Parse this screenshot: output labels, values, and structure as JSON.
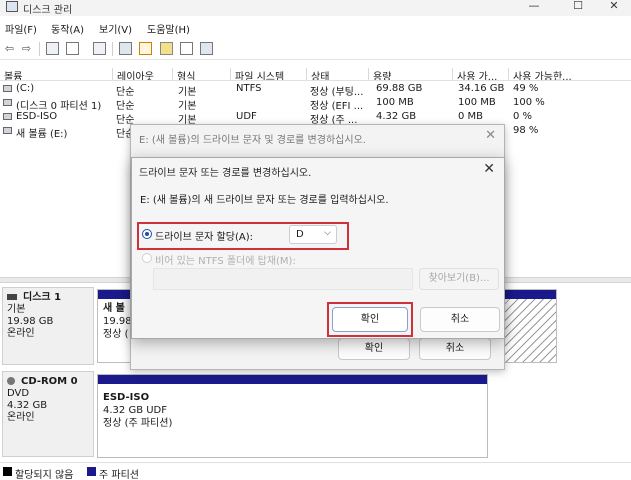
{
  "window": {
    "title": "디스크 관리",
    "minimize": "—",
    "maximize": "☐",
    "close": "✕"
  },
  "menu": [
    "파일(F)",
    "동작(A)",
    "보기(V)",
    "도움말(H)"
  ],
  "toolbar": {
    "back_icon": "arrow-left-icon",
    "forward_icon": "arrow-right-icon",
    "back_glyph": "⇦",
    "forward_glyph": "⇨"
  },
  "volume_list": {
    "columns": [
      "볼륨",
      "레이아웃",
      "형식",
      "파일 시스템",
      "상태",
      "용량",
      "사용 가...",
      "사용 가능한..."
    ],
    "rows": [
      [
        "(C:)",
        "단순",
        "기본",
        "NTFS",
        "정상 (부팅...",
        "69.88 GB",
        "34.16 GB",
        "49 %"
      ],
      [
        "(디스크 0 파티션 1)",
        "단순",
        "기본",
        "",
        "정상 (EFI ...",
        "100 MB",
        "100 MB",
        "100 %"
      ],
      [
        "ESD-ISO",
        "단순",
        "기본",
        "UDF",
        "정상 (주 ...",
        "4.32 GB",
        "0 MB",
        "0 %"
      ],
      [
        "새 볼륨 (E:)",
        "단순",
        "",
        "",
        "",
        "",
        "",
        "98 %"
      ]
    ]
  },
  "disks": [
    {
      "name": "디스크 1",
      "type": "기본",
      "size": "19.98 GB",
      "status": "온라인",
      "partition": {
        "line1": "새 볼",
        "line2": "19.98",
        "line3": "정상 ("
      }
    },
    {
      "name": "CD-ROM 0",
      "type": "DVD",
      "size": "4.32 GB",
      "status": "온라인",
      "partition": {
        "line1": "ESD-ISO",
        "line2": "4.32 GB UDF",
        "line3": "정상 (주 파티션)"
      }
    }
  ],
  "legend": {
    "unallocated": "할당되지 않음",
    "primary": "주 파티션",
    "unallocated_color": "#000000",
    "primary_color": "#1a1a8c"
  },
  "back_dialog": {
    "title": "E: (새 볼륨)의 드라이브 문자 및 경로를 변경하십시오.",
    "ok_label": "확인",
    "cancel_label": "취소"
  },
  "front_dialog": {
    "title": "드라이브 문자 또는 경로를 변경하십시오.",
    "prompt": "E: (새 볼륨)의 새 드라이브 문자 또는 경로를 입력하십시오.",
    "assign_letter_label": "드라이브 문자 할당(A):",
    "drive_letter": "D",
    "mount_folder_label": "비어 있는 NTFS 폴더에 탑재(M):",
    "browse_label": "찾아보기(B)...",
    "ok_label": "확인",
    "cancel_label": "취소"
  },
  "colors": {
    "highlight": "#d0303a",
    "partition_bar": "#1a1a8c",
    "radio_accent": "#1f4eaa"
  }
}
